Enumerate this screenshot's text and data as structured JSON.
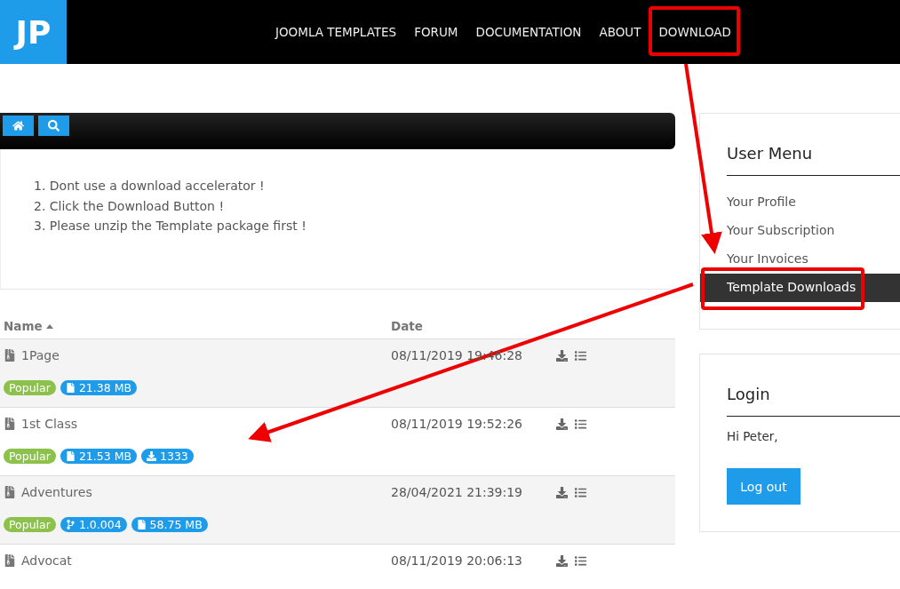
{
  "header": {
    "logo": "JP",
    "nav": [
      "JOOMLA TEMPLATES",
      "FORUM",
      "DOCUMENTATION",
      "ABOUT",
      "DOWNLOAD"
    ]
  },
  "instructions": [
    "1. Dont use a download accelerator !",
    "2. Click the Download Button !",
    "3. Please unzip the Template package first !"
  ],
  "table": {
    "columns": [
      "Name",
      "Date"
    ],
    "rows": [
      {
        "name": "1Page",
        "date": "08/11/2019 19:46:28",
        "badges": [
          {
            "kind": "popular",
            "text": "Popular"
          },
          {
            "kind": "size",
            "text": "21.38 MB"
          }
        ]
      },
      {
        "name": "1st Class",
        "date": "08/11/2019 19:52:26",
        "badges": [
          {
            "kind": "popular",
            "text": "Popular"
          },
          {
            "kind": "size",
            "text": "21.53 MB"
          },
          {
            "kind": "downloads",
            "text": "1333"
          }
        ]
      },
      {
        "name": "Adventures",
        "date": "28/04/2021 21:39:19",
        "badges": [
          {
            "kind": "popular",
            "text": "Popular"
          },
          {
            "kind": "version",
            "text": "1.0.004"
          },
          {
            "kind": "size",
            "text": "58.75 MB"
          }
        ]
      },
      {
        "name": "Advocat",
        "date": "08/11/2019 20:06:13",
        "badges": []
      }
    ]
  },
  "user_menu": {
    "title": "User Menu",
    "items": [
      {
        "label": "Your Profile",
        "selected": false
      },
      {
        "label": "Your Subscription",
        "selected": false
      },
      {
        "label": "Your Invoices",
        "selected": false
      },
      {
        "label": "Template Downloads",
        "selected": true
      }
    ]
  },
  "login": {
    "title": "Login",
    "greeting": "Hi Peter,",
    "button": "Log out"
  },
  "annotations": [
    {
      "kind": "box"
    },
    {
      "kind": "box"
    },
    {
      "kind": "arrow"
    },
    {
      "kind": "arrow"
    }
  ]
}
